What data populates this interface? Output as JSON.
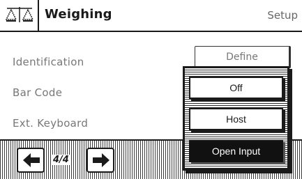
{
  "header": {
    "icon": "balance-scale-icon",
    "title": "Weighing",
    "mode": "Setup"
  },
  "rows": [
    {
      "label": "Identification"
    },
    {
      "label": "Bar Code"
    },
    {
      "label": "Ext. Keyboard"
    }
  ],
  "define_button": {
    "label": "Define"
  },
  "dropdown": {
    "options": [
      {
        "label": "Off",
        "selected": false
      },
      {
        "label": "Host",
        "selected": false
      },
      {
        "label": "Open Input",
        "selected": true
      }
    ]
  },
  "navigation": {
    "page_indicator": "4/4",
    "prev_icon": "arrow-left-icon",
    "next_icon": "arrow-right-icon"
  }
}
